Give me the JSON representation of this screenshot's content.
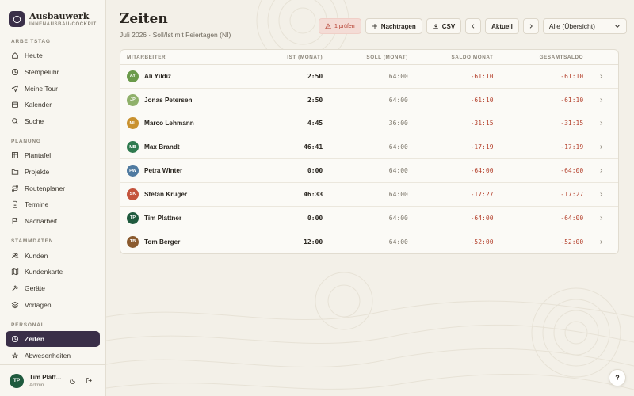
{
  "brand": {
    "title": "Ausbauwerk",
    "subtitle": "INNENAUSBAU-COCKPIT"
  },
  "sidebar": {
    "sections": [
      {
        "label": "ARBEITSTAG",
        "items": [
          {
            "label": "Heute",
            "icon": "home-icon"
          },
          {
            "label": "Stempeluhr",
            "icon": "clock-icon"
          },
          {
            "label": "Meine Tour",
            "icon": "send-icon"
          },
          {
            "label": "Kalender",
            "icon": "calendar-icon"
          },
          {
            "label": "Suche",
            "icon": "search-icon"
          }
        ]
      },
      {
        "label": "PLANUNG",
        "items": [
          {
            "label": "Plantafel",
            "icon": "grid-icon"
          },
          {
            "label": "Projekte",
            "icon": "folder-icon"
          },
          {
            "label": "Routenplaner",
            "icon": "route-icon"
          },
          {
            "label": "Termine",
            "icon": "document-icon"
          },
          {
            "label": "Nacharbeit",
            "icon": "flag-icon"
          }
        ]
      },
      {
        "label": "STAMMDATEN",
        "items": [
          {
            "label": "Kunden",
            "icon": "users-icon"
          },
          {
            "label": "Kundenkarte",
            "icon": "map-icon"
          },
          {
            "label": "Geräte",
            "icon": "hammer-icon"
          },
          {
            "label": "Vorlagen",
            "icon": "layers-icon"
          }
        ]
      },
      {
        "label": "PERSONAL",
        "items": [
          {
            "label": "Zeiten",
            "icon": "clock-icon",
            "active": true
          },
          {
            "label": "Abwesenheiten",
            "icon": "sun-icon"
          }
        ]
      }
    ]
  },
  "user": {
    "initials": "TP",
    "name": "Tim Platt...",
    "role": "Admin"
  },
  "header": {
    "title": "Zeiten",
    "subtitle": "Juli 2026 · Soll/Ist mit Feiertagen (NI)"
  },
  "toolbar": {
    "warning_label": "1 prüfen",
    "add_label": "Nachtragen",
    "csv_label": "CSV",
    "current_label": "Aktuell",
    "filter_value": "Alle (Übersicht)"
  },
  "table": {
    "columns": [
      "MITARBEITER",
      "IST (MONAT)",
      "SOLL (MONAT)",
      "SALDO MONAT",
      "GESAMTSALDO"
    ],
    "rows": [
      {
        "initials": "AY",
        "name": "Ali Yıldız",
        "ist": "2:50",
        "soll": "64:00",
        "saldo": "-61:10",
        "gesamt": "-61:10",
        "color": "#6a9a4a"
      },
      {
        "initials": "JP",
        "name": "Jonas Petersen",
        "ist": "2:50",
        "soll": "64:00",
        "saldo": "-61:10",
        "gesamt": "-61:10",
        "color": "#8fb06a"
      },
      {
        "initials": "ML",
        "name": "Marco Lehmann",
        "ist": "4:45",
        "soll": "36:00",
        "saldo": "-31:15",
        "gesamt": "-31:15",
        "color": "#c9912e"
      },
      {
        "initials": "MB",
        "name": "Max Brandt",
        "ist": "46:41",
        "soll": "64:00",
        "saldo": "-17:19",
        "gesamt": "-17:19",
        "color": "#2e7a4f"
      },
      {
        "initials": "PW",
        "name": "Petra Winter",
        "ist": "0:00",
        "soll": "64:00",
        "saldo": "-64:00",
        "gesamt": "-64:00",
        "color": "#4f7aa0"
      },
      {
        "initials": "SK",
        "name": "Stefan Krüger",
        "ist": "46:33",
        "soll": "64:00",
        "saldo": "-17:27",
        "gesamt": "-17:27",
        "color": "#c4533c"
      },
      {
        "initials": "TP",
        "name": "Tim Plattner",
        "ist": "0:00",
        "soll": "64:00",
        "saldo": "-64:00",
        "gesamt": "-64:00",
        "color": "#1f5a3e"
      },
      {
        "initials": "TB",
        "name": "Tom Berger",
        "ist": "12:00",
        "soll": "64:00",
        "saldo": "-52:00",
        "gesamt": "-52:00",
        "color": "#8a5a2e"
      }
    ]
  },
  "help_label": "?",
  "colors": {
    "accent": "#3a2f48",
    "negative": "#b5432f",
    "background": "#f3f0e8"
  }
}
